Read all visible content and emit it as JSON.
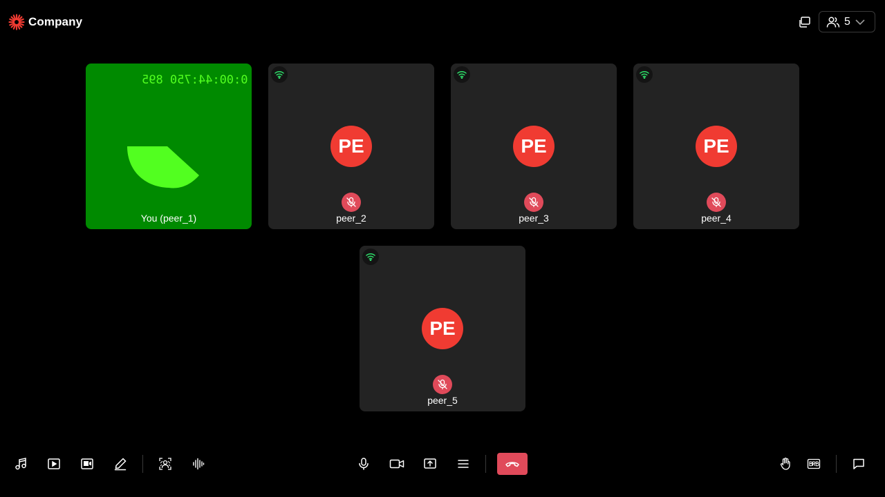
{
  "header": {
    "company_name": "Company",
    "logo_icon": "starburst-logo-icon",
    "participant_count": "5"
  },
  "colors": {
    "background": "#000000",
    "tile_background": "#232323",
    "local_tile_background": "#008a00",
    "avatar": "#f03b32",
    "muted_badge": "#e04a5a",
    "leave_button": "#e04a5a",
    "network_good": "#2ee06a",
    "timecode": "#52ff20"
  },
  "tiles": [
    {
      "name": "You (peer_1)",
      "timecode": "0:00:44:750 895",
      "is_local": true
    },
    {
      "name": "peer_2",
      "initials": "PE",
      "muted": true,
      "network_icon": "wifi-icon"
    },
    {
      "name": "peer_3",
      "initials": "PE",
      "muted": true,
      "network_icon": "wifi-icon"
    },
    {
      "name": "peer_4",
      "initials": "PE",
      "muted": true,
      "network_icon": "wifi-icon"
    },
    {
      "name": "peer_5",
      "initials": "PE",
      "muted": true,
      "network_icon": "wifi-icon"
    }
  ],
  "toolbar": {
    "left": [
      "music-icon",
      "video-play-icon",
      "video-library-icon",
      "whiteboard-pen-icon",
      "virtual-background-icon",
      "noise-suppression-icon"
    ],
    "center": [
      "microphone-icon",
      "camera-icon",
      "screen-share-icon",
      "more-menu-icon",
      "leave-call-icon"
    ],
    "right": [
      "raise-hand-icon",
      "brb-icon",
      "chat-icon"
    ]
  }
}
